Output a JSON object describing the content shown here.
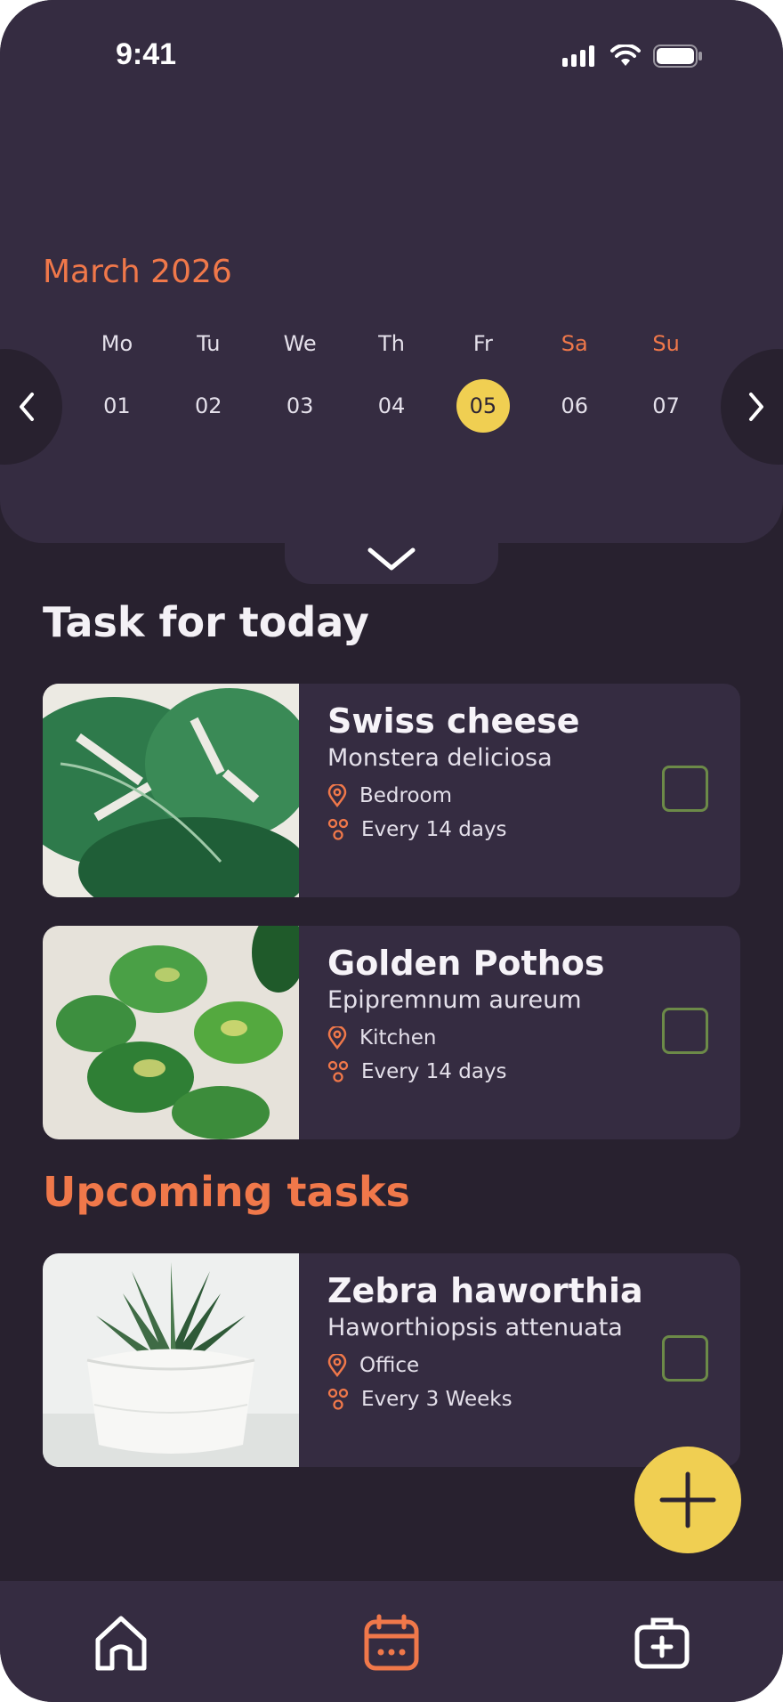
{
  "status_bar": {
    "time": "9:41"
  },
  "calendar": {
    "month_title": "March 2026",
    "weekdays": [
      "Mo",
      "Tu",
      "We",
      "Th",
      "Fr",
      "Sa",
      "Su"
    ],
    "dates": [
      "01",
      "02",
      "03",
      "04",
      "05",
      "06",
      "07"
    ],
    "selected_date": "05"
  },
  "sections": {
    "today_title": "Task for today",
    "upcoming_title": "Upcoming tasks"
  },
  "today_tasks": [
    {
      "name": "Swiss cheese",
      "scientific_name": "Monstera deliciosa",
      "location": "Bedroom",
      "frequency": "Every 14 days",
      "done": false
    },
    {
      "name": "Golden Pothos",
      "scientific_name": "Epipremnum aureum",
      "location": "Kitchen",
      "frequency": "Every 14 days",
      "done": false
    }
  ],
  "upcoming_tasks": [
    {
      "name": "Zebra haworthia",
      "scientific_name": "Haworthiopsis attenuata",
      "location": "Office",
      "frequency": "Every 3 Weeks",
      "done": false
    }
  ],
  "colors": {
    "background": "#28212f",
    "panel": "#352c41",
    "accent_orange": "#f0784a",
    "accent_yellow": "#f0cf52",
    "checkbox_green": "#6c8a48"
  },
  "icons": {
    "nav": [
      "home-icon",
      "calendar-icon",
      "first-aid-kit-icon"
    ],
    "task_meta": [
      "location-pin-icon",
      "water-drops-icon"
    ]
  }
}
